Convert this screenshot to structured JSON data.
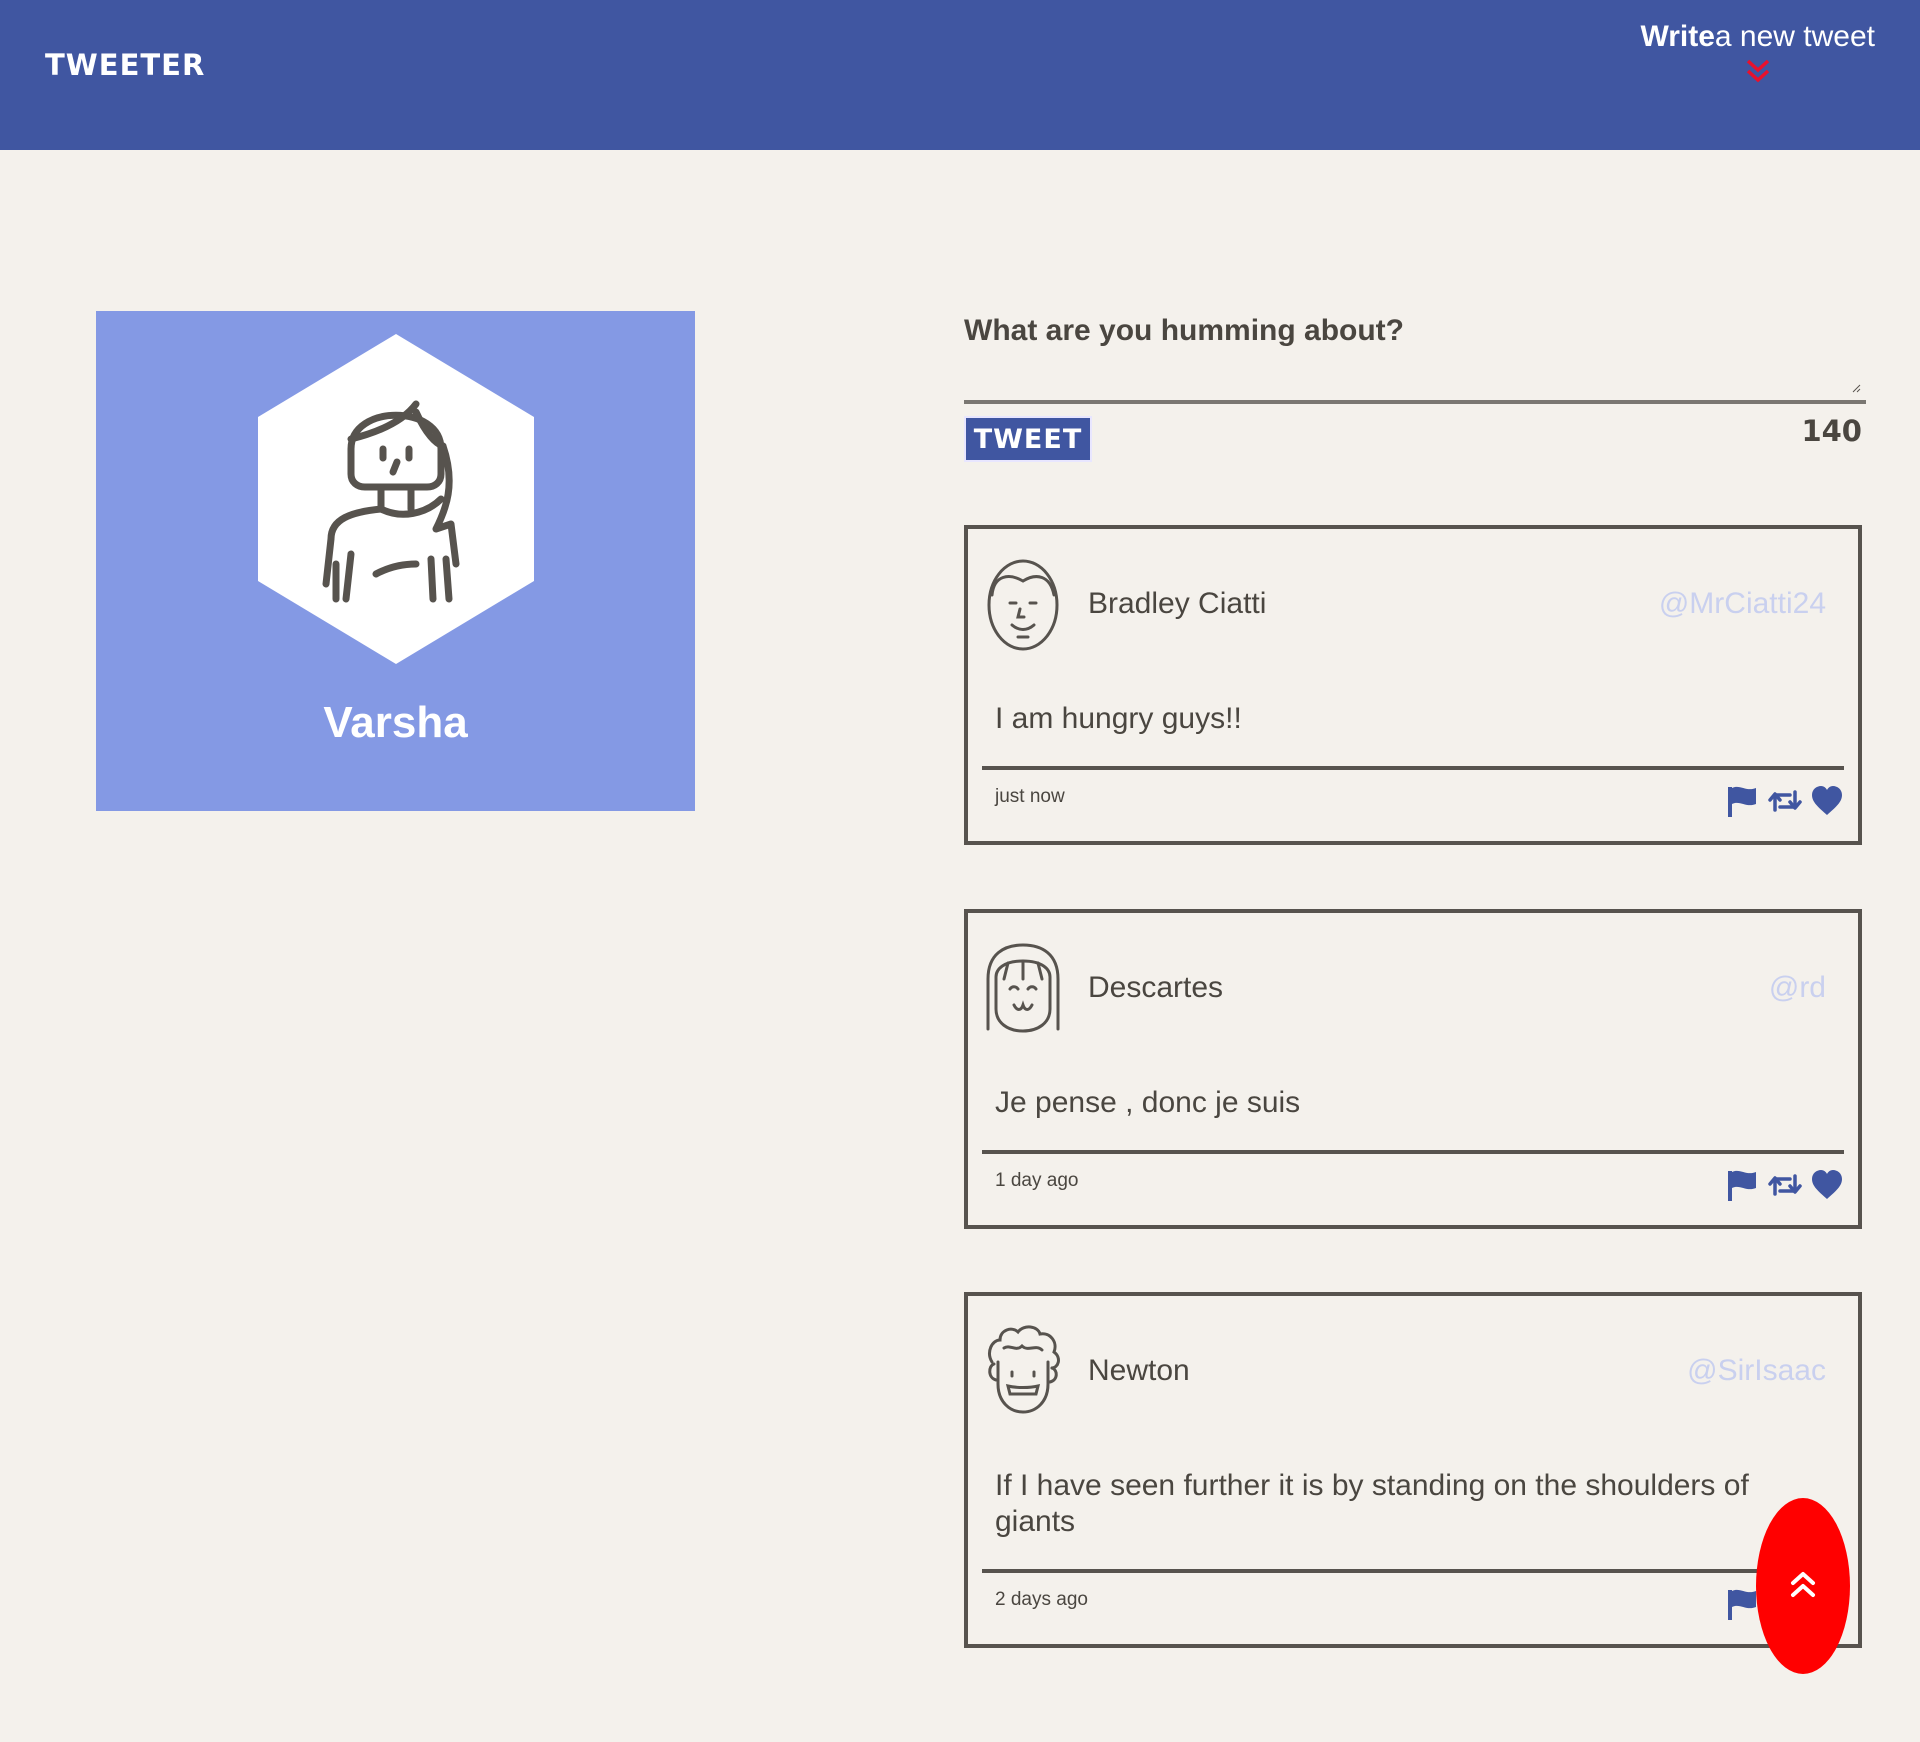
{
  "header": {
    "brand": "TWEETER",
    "compose_toggle_strong": "Write",
    "compose_toggle_rest": "a new tweet",
    "chevron_icon": "double-chevron-down-icon",
    "chevron_color": "#e8112d"
  },
  "profile": {
    "name": "Varsha",
    "avatar_icon": "woman-avatar-icon",
    "background_color": "#8499e4"
  },
  "composer": {
    "label": "What are you humming about?",
    "value": "",
    "button_label": "TWEET",
    "char_count": "140"
  },
  "tweets": [
    {
      "author": "Bradley Ciatti",
      "handle": "@MrCiatti24",
      "body": "I am hungry guys!!",
      "time": "just now",
      "avatar_icon": "man-avatar-icon"
    },
    {
      "author": "Descartes",
      "handle": "@rd",
      "body": "Je pense , donc je suis",
      "time": "1 day ago",
      "avatar_icon": "bangs-avatar-icon"
    },
    {
      "author": "Newton",
      "handle": "@SirIsaac",
      "body": "If I have seen further it is by standing on the shoulders of giants",
      "time": "2 days ago",
      "avatar_icon": "curly-hair-avatar-icon"
    }
  ],
  "tweet_actions": [
    "flag-icon",
    "retweet-icon",
    "heart-icon"
  ],
  "scroll_top_icon": "double-chevron-up-icon",
  "colors": {
    "brand": "#4056a1",
    "background": "#f4f1ec",
    "text": "#4a4640",
    "handle": "#c9d0ef",
    "scroll_button": "#ff0000"
  }
}
